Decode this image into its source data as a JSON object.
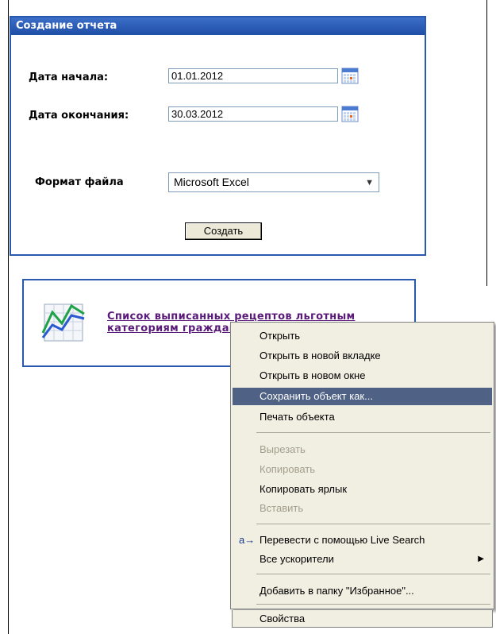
{
  "report_form": {
    "title": "Создание отчета",
    "start_date_label": "Дата начала:",
    "start_date_value": "01.01.2012",
    "end_date_label": "Дата окончания:",
    "end_date_value": "30.03.2012",
    "format_label": "Формат файла",
    "format_value": "Microsoft Excel",
    "create_button": "Создать"
  },
  "report_link": {
    "text": "Список выписанных рецептов льготным категориям граждан"
  },
  "context_menu": {
    "items": [
      {
        "label": "Открыть",
        "disabled": false
      },
      {
        "label": "Открыть в новой вкладке",
        "disabled": false
      },
      {
        "label": "Открыть в новом окне",
        "disabled": false
      },
      {
        "label": "Сохранить объект как...",
        "disabled": false,
        "highlighted": true
      },
      {
        "label": "Печать объекта",
        "disabled": false
      },
      {
        "label": "Вырезать",
        "disabled": true
      },
      {
        "label": "Копировать",
        "disabled": true
      },
      {
        "label": "Копировать ярлык",
        "disabled": false
      },
      {
        "label": "Вставить",
        "disabled": true
      },
      {
        "label": "Перевести с помощью Live Search",
        "disabled": false,
        "icon": "translate-icon"
      },
      {
        "label": "Все ускорители",
        "disabled": false,
        "submenu": true
      },
      {
        "label": "Добавить в папку \"Избранное\"...",
        "disabled": false
      },
      {
        "label": "Свойства",
        "disabled": false
      }
    ]
  },
  "colors": {
    "panel_border": "#2a5ab0",
    "menu_highlight": "#4f6184",
    "link": "#5a1a7a"
  }
}
